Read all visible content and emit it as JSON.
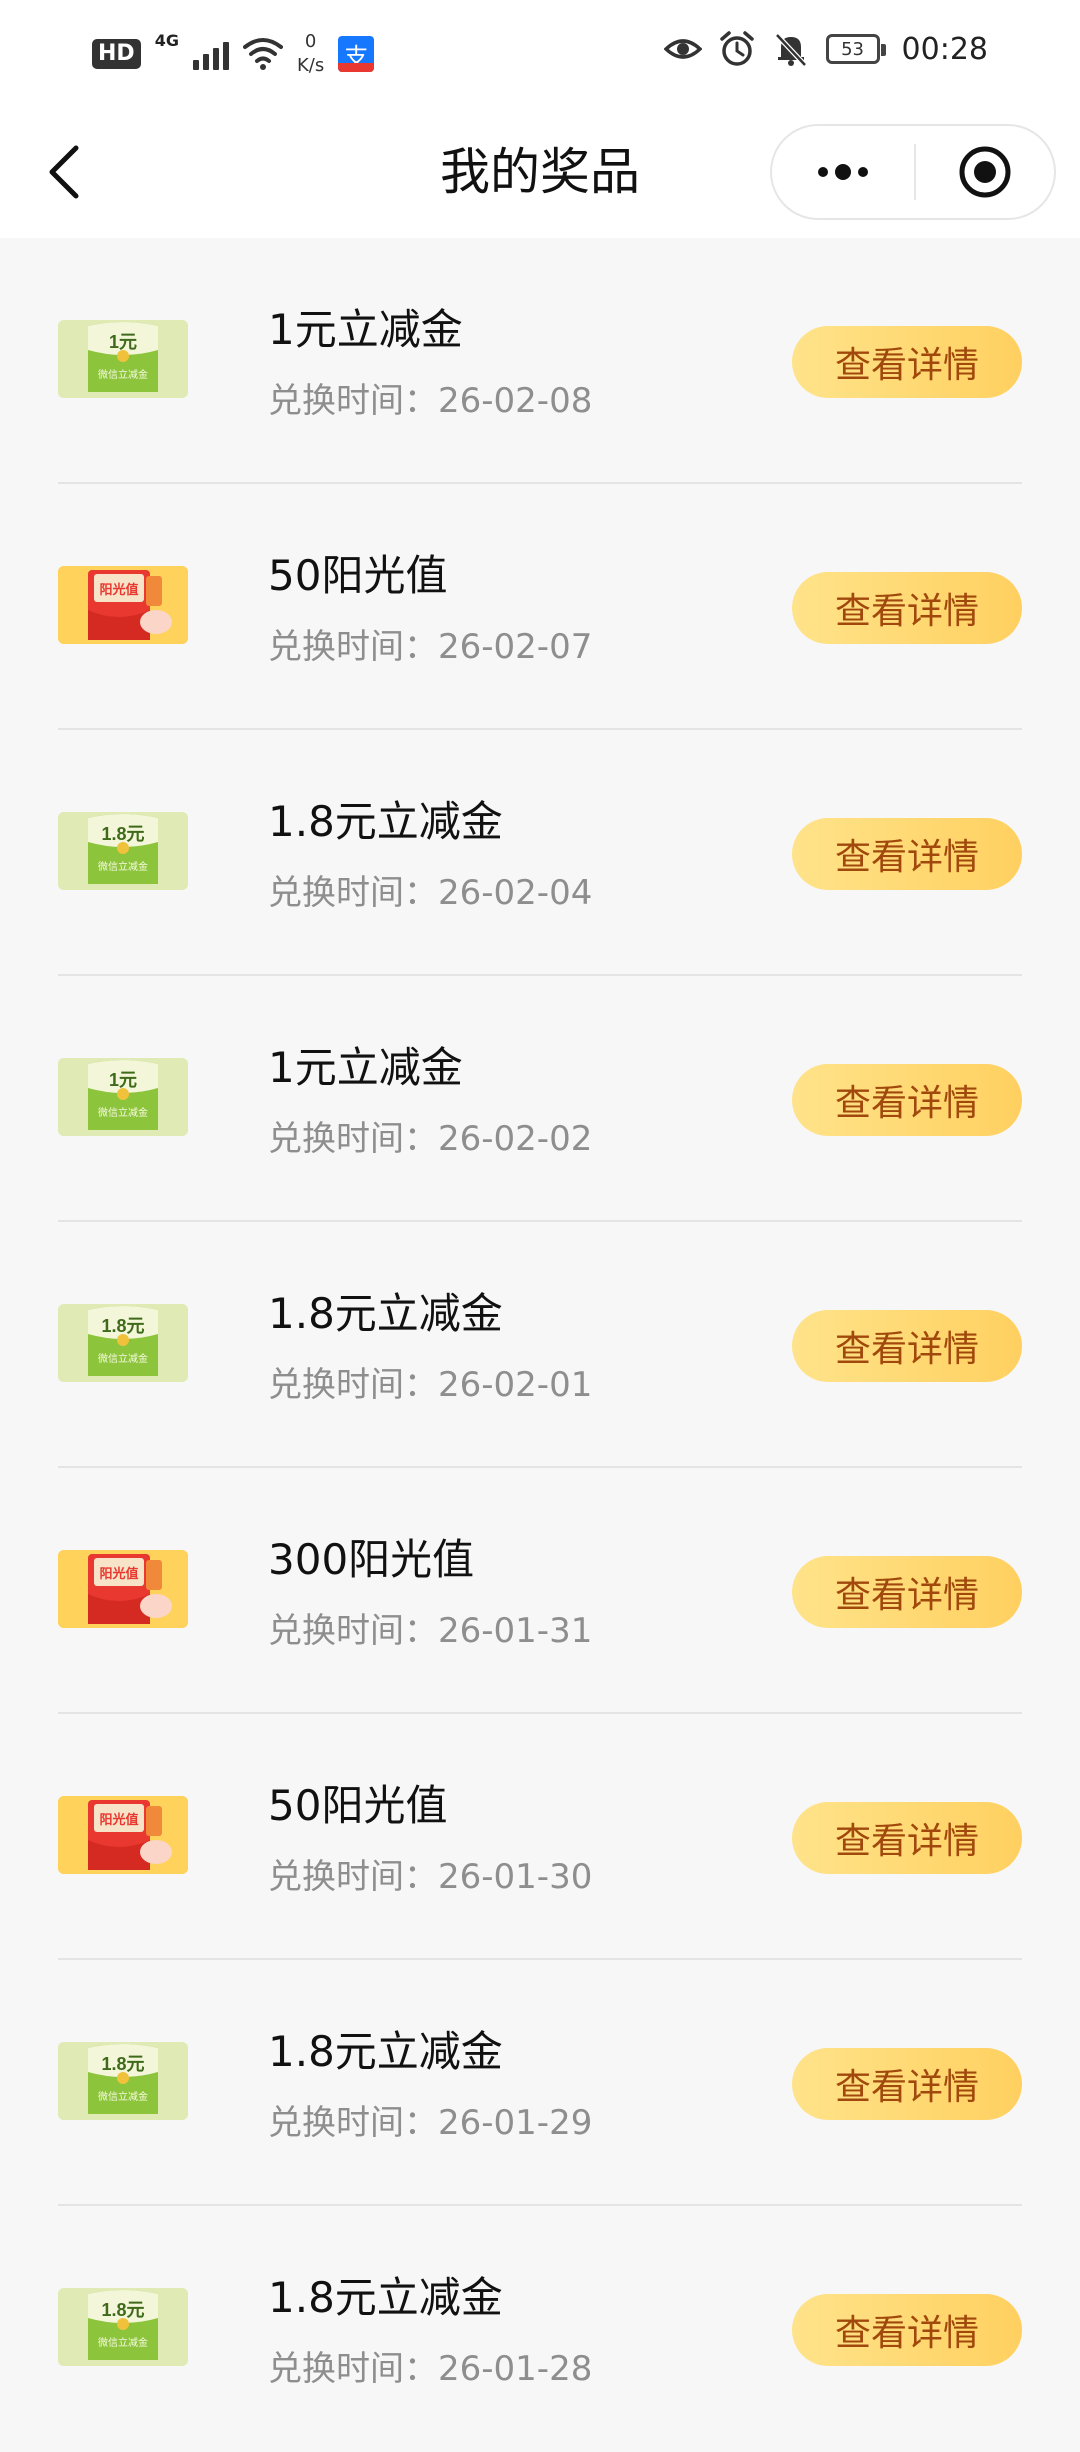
{
  "status_bar": {
    "hd": "HD",
    "network": "4G",
    "speed_value": "0",
    "speed_unit": "K/s",
    "alipay_char": "支",
    "battery": "53",
    "time": "00:28"
  },
  "nav": {
    "title": "我的奖品"
  },
  "date_prefix": "兑换时间：",
  "detail_label": "查看详情",
  "prizes": [
    {
      "name": "1元立减金",
      "date": "26-02-08",
      "icon": "coupon-1yuan-icon",
      "theme": "green",
      "amount": "1",
      "unit": "元"
    },
    {
      "name": "50阳光值",
      "date": "26-02-07",
      "icon": "sunshine-envelope-icon",
      "theme": "orange",
      "badge": "阳光值"
    },
    {
      "name": "1.8元立减金",
      "date": "26-02-04",
      "icon": "coupon-1-8yuan-icon",
      "theme": "green",
      "amount": "1.8",
      "unit": "元"
    },
    {
      "name": "1元立减金",
      "date": "26-02-02",
      "icon": "coupon-1yuan-icon",
      "theme": "green",
      "amount": "1",
      "unit": "元"
    },
    {
      "name": "1.8元立减金",
      "date": "26-02-01",
      "icon": "coupon-1-8yuan-icon",
      "theme": "green",
      "amount": "1.8",
      "unit": "元"
    },
    {
      "name": "300阳光值",
      "date": "26-01-31",
      "icon": "sunshine-envelope-icon",
      "theme": "orange",
      "badge": "阳光值"
    },
    {
      "name": "50阳光值",
      "date": "26-01-30",
      "icon": "sunshine-envelope-icon",
      "theme": "orange",
      "badge": "阳光值"
    },
    {
      "name": "1.8元立减金",
      "date": "26-01-29",
      "icon": "coupon-1-8yuan-icon",
      "theme": "green",
      "amount": "1.8",
      "unit": "元"
    },
    {
      "name": "1.8元立减金",
      "date": "26-01-28",
      "icon": "coupon-1-8yuan-icon",
      "theme": "green",
      "amount": "1.8",
      "unit": "元"
    }
  ],
  "coupon_caption": "微信立减金",
  "colors": {
    "button_start": "#ffe38a",
    "button_end": "#ffd060",
    "button_text": "#a1480c",
    "coupon_green": "#8cc43c",
    "sunshine_orange": "#ffd25c",
    "envelope_red": "#e8382f"
  }
}
